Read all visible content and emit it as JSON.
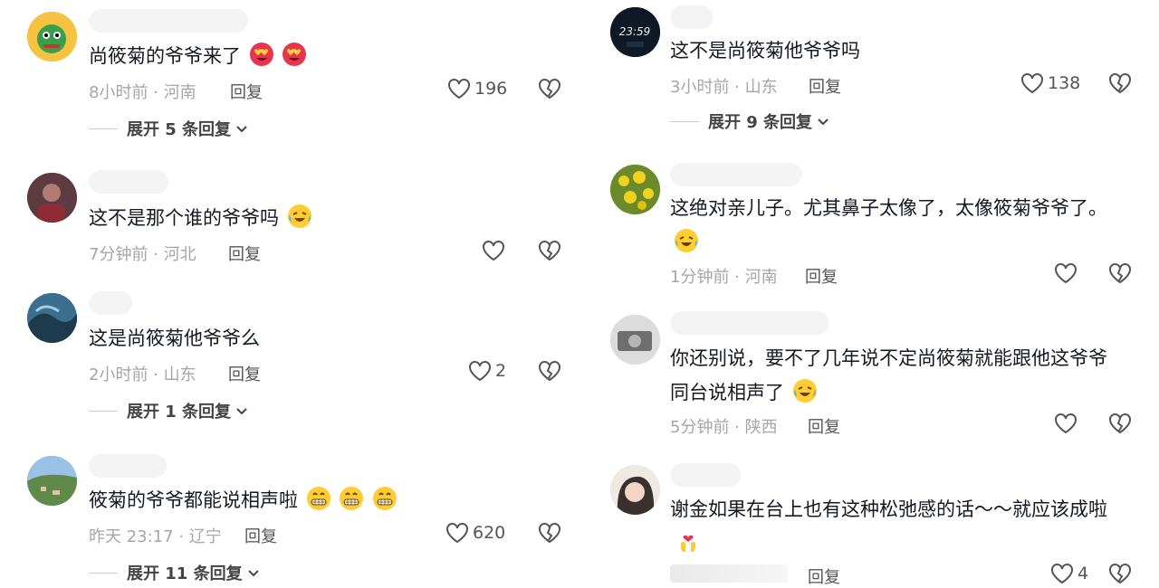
{
  "colors": {
    "text": "#161823",
    "meta": "#a6a6a6",
    "icon": "#555555",
    "accent_heart_face": "#e8344e",
    "emoji_yellow": "#ffcc33"
  },
  "left": [
    {
      "text": "尚筱菊的爷爷来了",
      "emojis": [
        "heart-eyes-emoji",
        "heart-eyes-emoji"
      ],
      "time": "8小时前",
      "location": "河南",
      "reply": "回复",
      "likes": "196",
      "expand": "展开 5 条回复"
    },
    {
      "text": "这不是那个谁的爷爷吗",
      "emojis": [
        "laugh-cry-emoji"
      ],
      "time": "7分钟前",
      "location": "河北",
      "reply": "回复",
      "likes": ""
    },
    {
      "text": "这是尚筱菊他爷爷么",
      "emojis": [],
      "time": "2小时前",
      "location": "山东",
      "reply": "回复",
      "likes": "2",
      "expand": "展开 1 条回复"
    },
    {
      "text": "筱菊的爷爷都能说相声啦",
      "emojis": [
        "grin-emoji",
        "grin-emoji",
        "grin-emoji"
      ],
      "time": "昨天 23:17",
      "location": "辽宁",
      "reply": "回复",
      "likes": "620",
      "expand": "展开 11 条回复"
    }
  ],
  "right": [
    {
      "text": "这不是尚筱菊他爷爷吗",
      "emojis": [],
      "time": "3小时前",
      "location": "山东",
      "reply": "回复",
      "likes": "138",
      "expand": "展开 9 条回复",
      "avatar_text": "23:59"
    },
    {
      "text": "这绝对亲儿子。尤其鼻子太像了，太像筱菊爷爷了。",
      "emojis": [
        "laugh-cry-emoji"
      ],
      "time": "1分钟前",
      "location": "河南",
      "reply": "回复",
      "likes": ""
    },
    {
      "text": "你还别说，要不了几年说不定尚筱菊就能跟他这爷爷",
      "text2": "同台说相声了",
      "emojis": [
        "laugh-cry-emoji"
      ],
      "time": "5分钟前",
      "location": "陕西",
      "reply": "回复",
      "likes": ""
    },
    {
      "text": "谢金如果在台上也有这种松弛感的话～～就应该成啦",
      "emojis": [
        "heart-hands-emoji"
      ],
      "time": "",
      "location": "",
      "reply": "回复",
      "likes": "4"
    }
  ],
  "separator": " · "
}
